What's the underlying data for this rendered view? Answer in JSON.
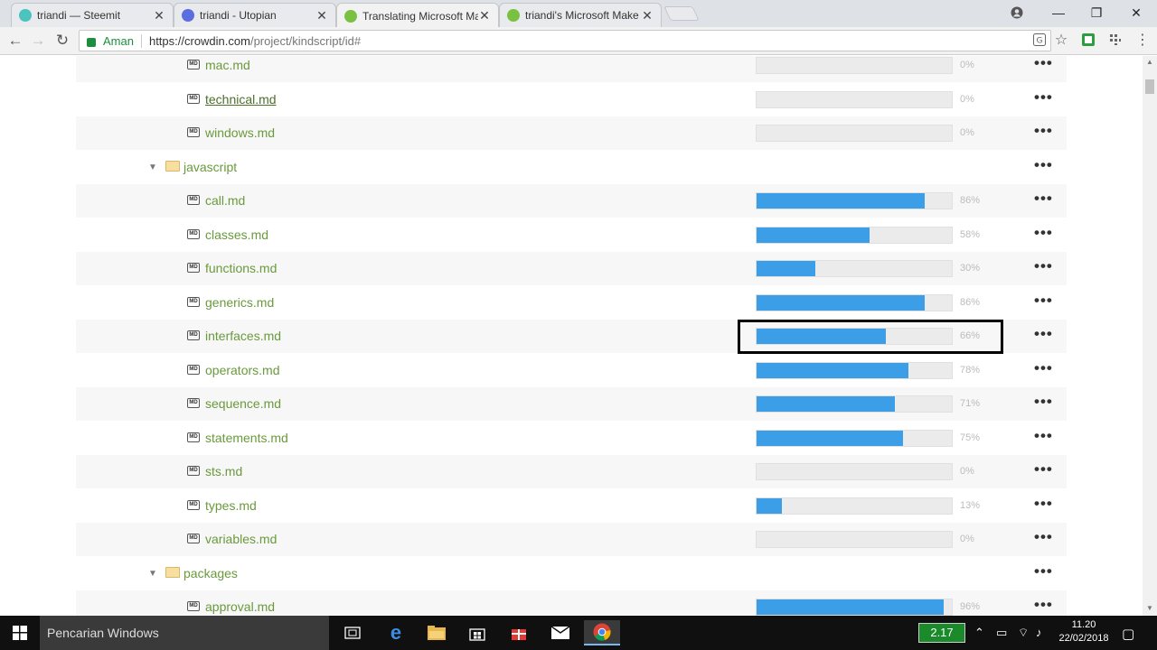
{
  "browser": {
    "tabs": [
      {
        "title": "triandi — Steemit",
        "favicon_color": "#4bc3be"
      },
      {
        "title": "triandi - Utopian",
        "favicon_color": "#5a6ee0"
      },
      {
        "title": "Translating Microsoft Ma",
        "favicon_color": "#7ac142"
      },
      {
        "title": "triandi's Microsoft Make",
        "favicon_color": "#7ac142"
      }
    ],
    "active_tab": 2,
    "secure_label": "Aman",
    "url_host": "https://crowdin.com",
    "url_path": "/project/kindscript/id#"
  },
  "files": {
    "top_items": [
      {
        "name": "mac.md",
        "percent": 0,
        "label": "0%"
      },
      {
        "name": "technical.md",
        "percent": 0,
        "label": "0%"
      },
      {
        "name": "windows.md",
        "percent": 0,
        "label": "0%"
      }
    ],
    "folder_javascript": "javascript",
    "javascript_items": [
      {
        "name": "call.md",
        "percent": 86,
        "label": "86%"
      },
      {
        "name": "classes.md",
        "percent": 58,
        "label": "58%"
      },
      {
        "name": "functions.md",
        "percent": 30,
        "label": "30%"
      },
      {
        "name": "generics.md",
        "percent": 86,
        "label": "86%"
      },
      {
        "name": "interfaces.md",
        "percent": 66,
        "label": "66%"
      },
      {
        "name": "operators.md",
        "percent": 78,
        "label": "78%"
      },
      {
        "name": "sequence.md",
        "percent": 71,
        "label": "71%"
      },
      {
        "name": "statements.md",
        "percent": 75,
        "label": "75%"
      },
      {
        "name": "sts.md",
        "percent": 0,
        "label": "0%"
      },
      {
        "name": "types.md",
        "percent": 13,
        "label": "13%"
      },
      {
        "name": "variables.md",
        "percent": 0,
        "label": "0%"
      }
    ],
    "folder_packages": "packages",
    "packages_items": [
      {
        "name": "approval.md",
        "percent": 96,
        "label": "96%"
      }
    ],
    "more_label": "•••",
    "md_label": "MD"
  },
  "taskbar": {
    "search_placeholder": "Pencarian Windows",
    "battery": "2.17",
    "time": "11.20",
    "date": "22/02/2018"
  },
  "colors": {
    "progress_fill": "#3d9ee8",
    "file_link": "#6a9a3c"
  }
}
